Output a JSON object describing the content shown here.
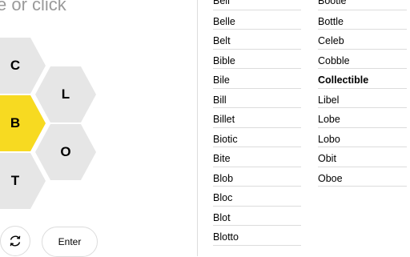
{
  "input": {
    "placeholder_tail": "e or click"
  },
  "hive": {
    "center_color": "#f7da21",
    "outer_color": "#e6e6e6",
    "letters": [
      {
        "id": "c",
        "letter": "C",
        "center": false
      },
      {
        "id": "l",
        "letter": "L",
        "center": false
      },
      {
        "id": "b",
        "letter": "B",
        "center": true
      },
      {
        "id": "o",
        "letter": "O",
        "center": false
      },
      {
        "id": "t",
        "letter": "T",
        "center": false
      }
    ]
  },
  "controls": {
    "shuffle_icon": "refresh-icon",
    "enter_label": "Enter"
  },
  "found_words": {
    "column1": [
      "Bell",
      "Belle",
      "Belt",
      "Bible",
      "Bile",
      "Bill",
      "Billet",
      "Biotic",
      "Bite",
      "Blob",
      "Bloc",
      "Blot",
      "Blotto"
    ],
    "column2": [
      "Bootie",
      "Bottle",
      "Celeb",
      "Cobble",
      "Collectible",
      "Libel",
      "Lobe",
      "Lobo",
      "Obit",
      "Oboe"
    ],
    "bold_words": [
      "Collectible"
    ]
  }
}
